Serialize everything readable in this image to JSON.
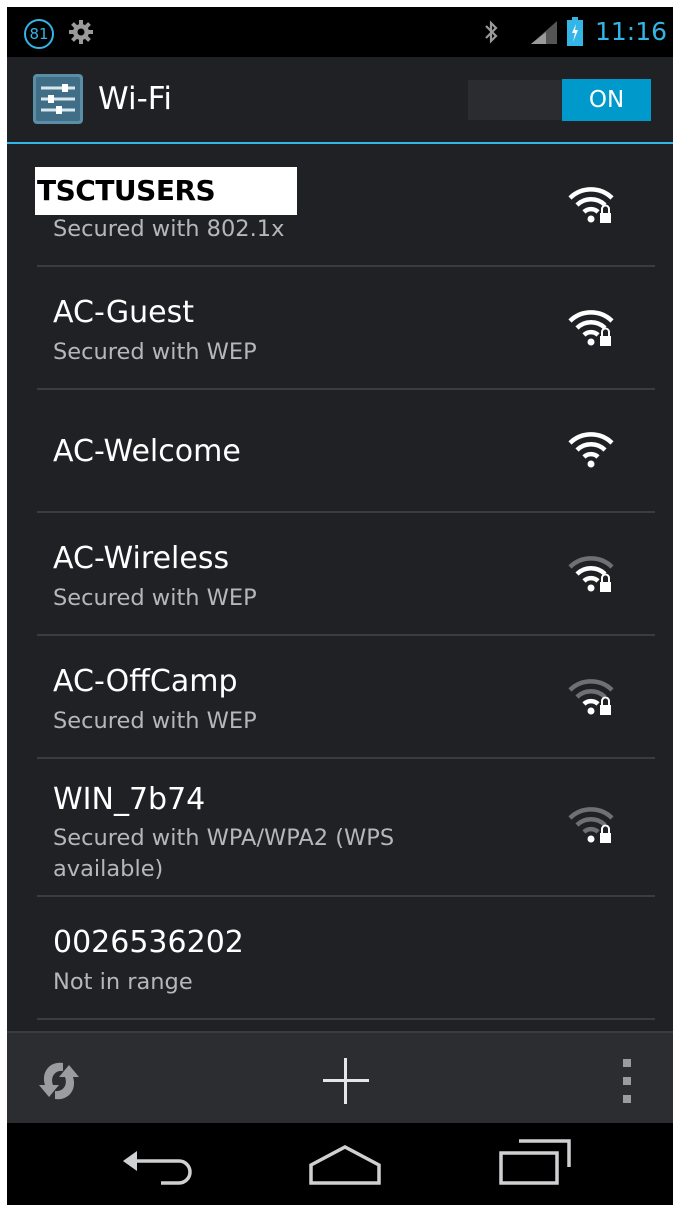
{
  "status_bar": {
    "notification_count": "81",
    "time": "11:16",
    "icons": [
      "settings-gear-icon",
      "bluetooth-icon",
      "cell-signal-icon",
      "battery-charging-icon"
    ]
  },
  "action_bar": {
    "title": "Wi-Fi",
    "app_icon": "settings-icon",
    "toggle_label": "ON",
    "toggle_state": "on"
  },
  "networks": [
    {
      "name": "TSCTUSERS",
      "status": "Secured with 802.1x",
      "icon": "wifi-secured-icon",
      "signal": 4,
      "secured": true
    },
    {
      "name": "AC-Guest",
      "status": "Secured with WEP",
      "icon": "wifi-secured-icon",
      "signal": 4,
      "secured": true
    },
    {
      "name": "AC-Welcome",
      "status": "",
      "icon": "wifi-open-icon",
      "signal": 4,
      "secured": false
    },
    {
      "name": "AC-Wireless",
      "status": "Secured with WEP",
      "icon": "wifi-secured-icon",
      "signal": 3,
      "secured": true
    },
    {
      "name": "AC-OffCamp",
      "status": "Secured with WEP",
      "icon": "wifi-secured-icon",
      "signal": 2,
      "secured": true
    },
    {
      "name": "WIN_7b74",
      "status": "Secured with WPA/WPA2 (WPS available)",
      "icon": "wifi-secured-icon",
      "signal": 1,
      "secured": true
    },
    {
      "name": "0026536202",
      "status": "Not in range",
      "icon": "",
      "signal": 0,
      "secured": false
    }
  ],
  "bottom_bar": {
    "icons": [
      "wps-refresh-icon",
      "add-network-icon",
      "overflow-menu-icon"
    ]
  },
  "nav_bar": {
    "icons": [
      "back-icon",
      "home-icon",
      "recents-icon"
    ]
  },
  "colors": {
    "accent": "#33b5e5",
    "background": "#1f2124",
    "toggle_on": "#0099cc",
    "wifi_bright": "#ffffff",
    "wifi_dim": "#6e7073"
  }
}
